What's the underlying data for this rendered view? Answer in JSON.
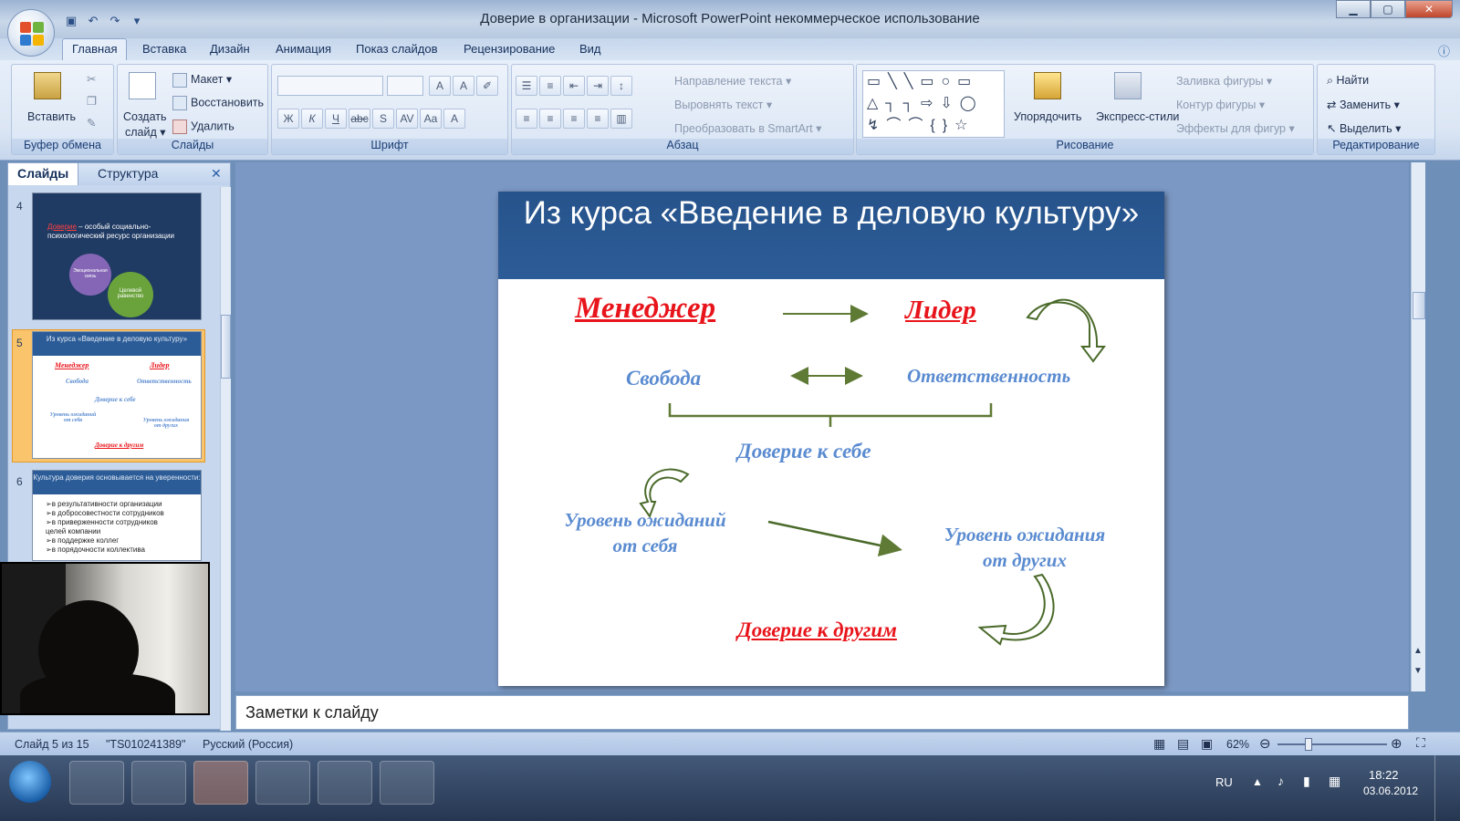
{
  "window": {
    "title": "Доверие в организации - Microsoft PowerPoint некоммерческое использование"
  },
  "ribbon_tabs": [
    "Главная",
    "Вставка",
    "Дизайн",
    "Анимация",
    "Показ слайдов",
    "Рецензирование",
    "Вид"
  ],
  "ribbon": {
    "clipboard": {
      "paste": "Вставить",
      "label": "Буфер обмена"
    },
    "slides": {
      "create": "Создать",
      "create2": "слайд ▾",
      "layout": "Макет ▾",
      "reset": "Восстановить",
      "delete": "Удалить",
      "label": "Слайды"
    },
    "font": {
      "label": "Шрифт"
    },
    "paragraph": {
      "direction": "Направление текста ▾",
      "align": "Выровнять текст ▾",
      "smartart": "Преобразовать в SmartArt ▾",
      "label": "Абзац"
    },
    "drawing": {
      "arrange": "Упорядочить",
      "styles": "Экспресс-стили",
      "fill": "Заливка фигуры ▾",
      "outline": "Контур фигуры ▾",
      "effects": "Эффекты для фигур ▾",
      "label": "Рисование"
    },
    "editing": {
      "find": "Найти",
      "replace": "Заменить ▾",
      "select": "Выделить ▾",
      "label": "Редактирование"
    }
  },
  "left_pane": {
    "tab_slides": "Слайды",
    "tab_outline": "Структура",
    "thumbs": [
      {
        "num": "4",
        "line1": "Доверие",
        "line1b": " – особый социально-",
        "line2": "психологический ресурс организации",
        "gear1": "Эмоциональная связь",
        "gear2": "Целевой равенство"
      },
      {
        "num": "5",
        "title": "Из курса «Введение в деловую культуру»",
        "a": "Менеджер",
        "b": "Лидер",
        "c": "Свобода",
        "d": "Ответственность",
        "e": "Доверие к себе",
        "f": "Уровень ожиданий от себя",
        "g": "Уровень ожидания от других",
        "h": "Доверие к другим"
      },
      {
        "num": "6",
        "title": "Культура доверия основывается на уверенности:",
        "items": [
          "в результативности организации",
          "в добросовестности сотрудников",
          "в приверженности сотрудников целей компании",
          "в поддержке коллег",
          "в порядочности коллектива"
        ]
      }
    ]
  },
  "slide": {
    "title": "Из курса «Введение в деловую культуру»",
    "manager": "Менеджер",
    "leader": "Лидер",
    "freedom": "Свобода",
    "responsibility": "Ответственность",
    "self_trust": "Доверие к себе",
    "expect_self_1": "Уровень ожиданий",
    "expect_self_2": "от себя",
    "expect_others_1": "Уровень ожидания",
    "expect_others_2": "от других",
    "trust_others": "Доверие к другим"
  },
  "notes": {
    "placeholder": "Заметки к слайду"
  },
  "status": {
    "slide": "Слайд 5 из 15",
    "theme": "\"TS010241389\"",
    "language": "Русский (Россия)",
    "zoom": "62%"
  },
  "tray": {
    "lang": "RU",
    "time": "18:22",
    "date": "03.06.2012"
  }
}
